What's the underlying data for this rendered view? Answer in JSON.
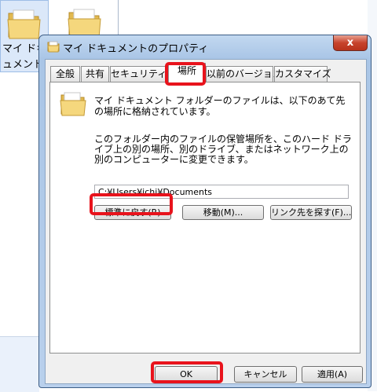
{
  "desktop": {
    "items": [
      {
        "label": "マイ ドキ\nュメント"
      },
      {
        "label": ""
      }
    ]
  },
  "dialog": {
    "title": "マイ ドキュメントのプロパティ",
    "close_label": "x",
    "tabs": [
      {
        "label": "全般"
      },
      {
        "label": "共有"
      },
      {
        "label": "セキュリティ"
      },
      {
        "label": "場所"
      },
      {
        "label": "以前のバージョン"
      },
      {
        "label": "カスタマイズ"
      }
    ],
    "active_tab": "場所",
    "location_tab": {
      "description": "マイ ドキュメント フォルダーのファイルは、以下のあて先の場所に格納されています。",
      "change_hint": "このフォルダー内のファイルの保管場所を、このハード ドライブ上の別の場所、別のドライブ、またはネットワーク上の別のコンピューターに変更できます。",
      "path_value": "C:¥Users¥ichi¥Documents",
      "restore_default_label": "標準に戻す(R)",
      "move_label": "移動(M)...",
      "find_target_label": "リンク先を探す(F)..."
    },
    "footer": {
      "ok_label": "OK",
      "cancel_label": "キャンセル",
      "apply_label": "適用(A)"
    }
  },
  "highlight_color": "#e8131c"
}
